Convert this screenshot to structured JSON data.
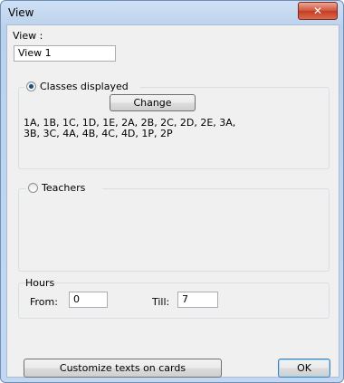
{
  "window": {
    "title": "View",
    "close_glyph": "✕"
  },
  "view_field": {
    "label": "View :",
    "value": "View 1"
  },
  "classes_group": {
    "radio_label": "Classes displayed",
    "selected": true,
    "change_button": "Change",
    "classes_line1": "1A, 1B, 1C, 1D, 1E, 2A, 2B, 2C, 2D, 2E, 3A,",
    "classes_line2": "3B, 3C, 4A, 4B, 4C, 4D, 1P, 2P"
  },
  "teachers_group": {
    "radio_label": "Teachers",
    "selected": false
  },
  "hours": {
    "legend": "Hours",
    "from_label": "From:",
    "from_value": "0",
    "till_label": "Till:",
    "till_value": "7"
  },
  "footer": {
    "customize_button": "Customize texts on cards",
    "ok_button": "OK"
  }
}
